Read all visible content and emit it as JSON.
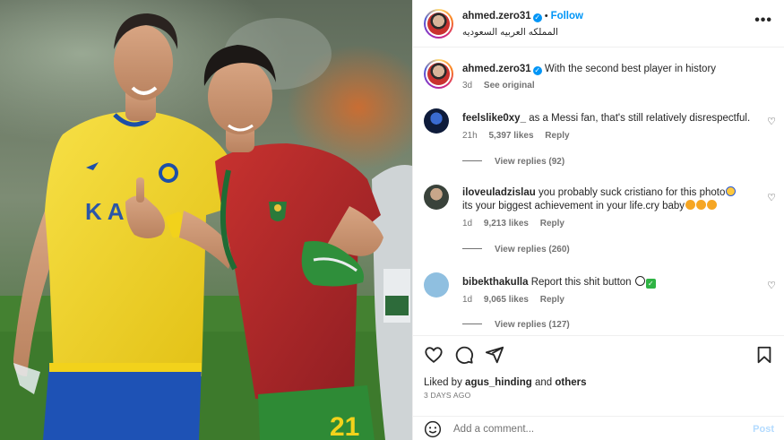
{
  "post": {
    "username": "ahmed.zero31",
    "follow_label": "Follow",
    "location": "المملكه العربيه السعوديه",
    "more_label": "•••"
  },
  "caption": {
    "username": "ahmed.zero31",
    "text": "With the second best player in history",
    "age": "3d",
    "see_original": "See original"
  },
  "comments": [
    {
      "username": "feelslike0xy_",
      "text": "as a Messi fan, that's still relatively disrespectful.",
      "age": "21h",
      "likes": "5,397 likes",
      "reply": "Reply",
      "view_replies": "View replies (92)"
    },
    {
      "username": "iloveuladzislau",
      "text": "you probably suck cristiano for this photo",
      "text2": "its your biggest achievement in your life.cry baby",
      "age": "1d",
      "likes": "9,213 likes",
      "reply": "Reply",
      "view_replies": "View replies (260)"
    },
    {
      "username": "bibekthakulla",
      "text": "Report this shit button",
      "age": "1d",
      "likes": "9,065 likes",
      "reply": "Reply",
      "view_replies": "View replies (127)"
    }
  ],
  "likes_summary": {
    "prefix": "Liked by",
    "user": "agus_hinding",
    "and": "and",
    "others": "others",
    "timestamp": "3 DAYS AGO"
  },
  "composer": {
    "placeholder": "Add a comment...",
    "post_label": "Post"
  },
  "photo": {
    "jersey_number": "21",
    "sponsor_text": "KAF"
  },
  "colors": {
    "accent": "#0095f6",
    "text": "#262626",
    "muted": "#737373",
    "yellow_kit": "#f2d21b",
    "red_kit": "#b3262a"
  }
}
